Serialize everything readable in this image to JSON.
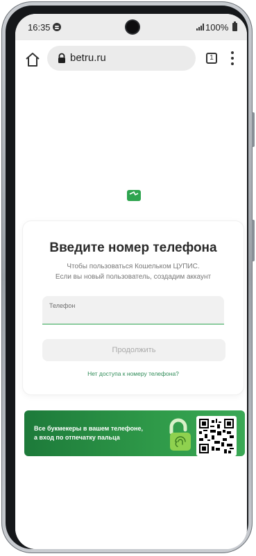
{
  "status_bar": {
    "time": "16:35",
    "battery": "100%"
  },
  "browser": {
    "url": "betru.ru",
    "tab_count": "1"
  },
  "card": {
    "title": "Введите номер телефона",
    "subtitle_line1": "Чтобы пользоваться Кошельком ЦУПИС.",
    "subtitle_line2": "Если вы новый пользователь, создадим аккаунт",
    "phone_label": "Телефон",
    "phone_value": "",
    "continue_label": "Продолжить",
    "no_access_link": "Нет доступа к номеру телефона?"
  },
  "banner": {
    "line1": "Все букмекеры в вашем телефоне,",
    "line2": "а вход по отпечатку пальца"
  },
  "colors": {
    "brand_green": "#2ea44f",
    "banner_green": "#1d7a3a",
    "link_green": "#2e8b57"
  },
  "icons": [
    "spotify-icon",
    "signal-icon",
    "battery-icon",
    "home-icon",
    "lock-icon",
    "tabs-icon",
    "menu-icon",
    "wallet-logo-icon",
    "fingerprint-lock-icon",
    "qr-code-icon"
  ]
}
